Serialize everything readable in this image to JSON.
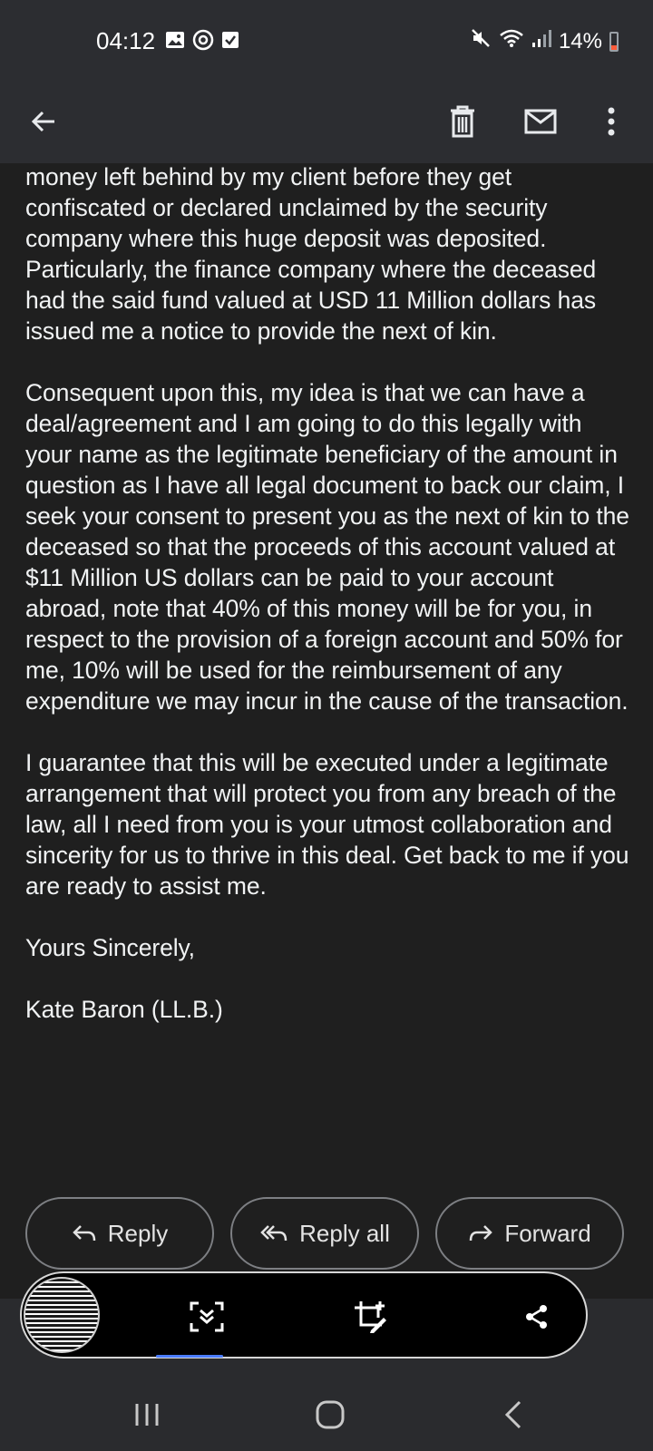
{
  "status_bar": {
    "time": "04:12",
    "battery": "14%",
    "left_icons": [
      "gallery-icon",
      "sync-icon",
      "checkbox-icon"
    ],
    "right_icons": [
      "mute-icon",
      "wifi-icon",
      "signal-icon",
      "battery-icon"
    ]
  },
  "app_bar": {
    "icons": [
      "back-arrow-icon",
      "delete-icon",
      "mark-unread-icon",
      "more-vertical-icon"
    ]
  },
  "email": {
    "paragraphs": [
      "money left behind by my client before they get confiscated or declared unclaimed by the security company where this huge deposit was deposited. Particularly, the finance company where the deceased had the said fund valued at USD 11 Million dollars has issued me a notice to provide the next of kin.",
      "Consequent upon this, my idea is that we can have a deal/agreement and I am going to do this legally with your name as the legitimate beneficiary of the amount in question as I have all legal document to back our claim, I seek your consent to present you as the next of kin to the deceased so that the proceeds of this account valued at $11 Million US dollars can be paid to your account abroad, note that 40% of this money will be for you, in respect to the provision of a foreign account and 50% for me, 10% will be used for the reimbursement of any expenditure we may incur in the cause of the transaction.",
      "I guarantee that this will be executed under a legitimate arrangement that will protect you from any breach of the law, all I need from you is your utmost collaboration and sincerity for us to thrive in this deal. Get back to me if you are ready to assist me.",
      "Yours Sincerely,",
      "Kate Baron (LL.B.)"
    ]
  },
  "actions": {
    "reply": "Reply",
    "reply_all": "Reply all",
    "forward": "Forward"
  },
  "capture_toolbar": {
    "icons": [
      "screenshot-thumbnail",
      "scroll-capture-icon",
      "crop-edit-icon",
      "share-icon"
    ]
  },
  "nav_bar": {
    "icons": [
      "recents-icon",
      "home-icon",
      "back-icon"
    ]
  },
  "colors": {
    "bar_background": "#2c2d31",
    "page_background": "#1f1f1f",
    "text": "#f1f3f4",
    "battery_low": "#ff5b3a"
  }
}
